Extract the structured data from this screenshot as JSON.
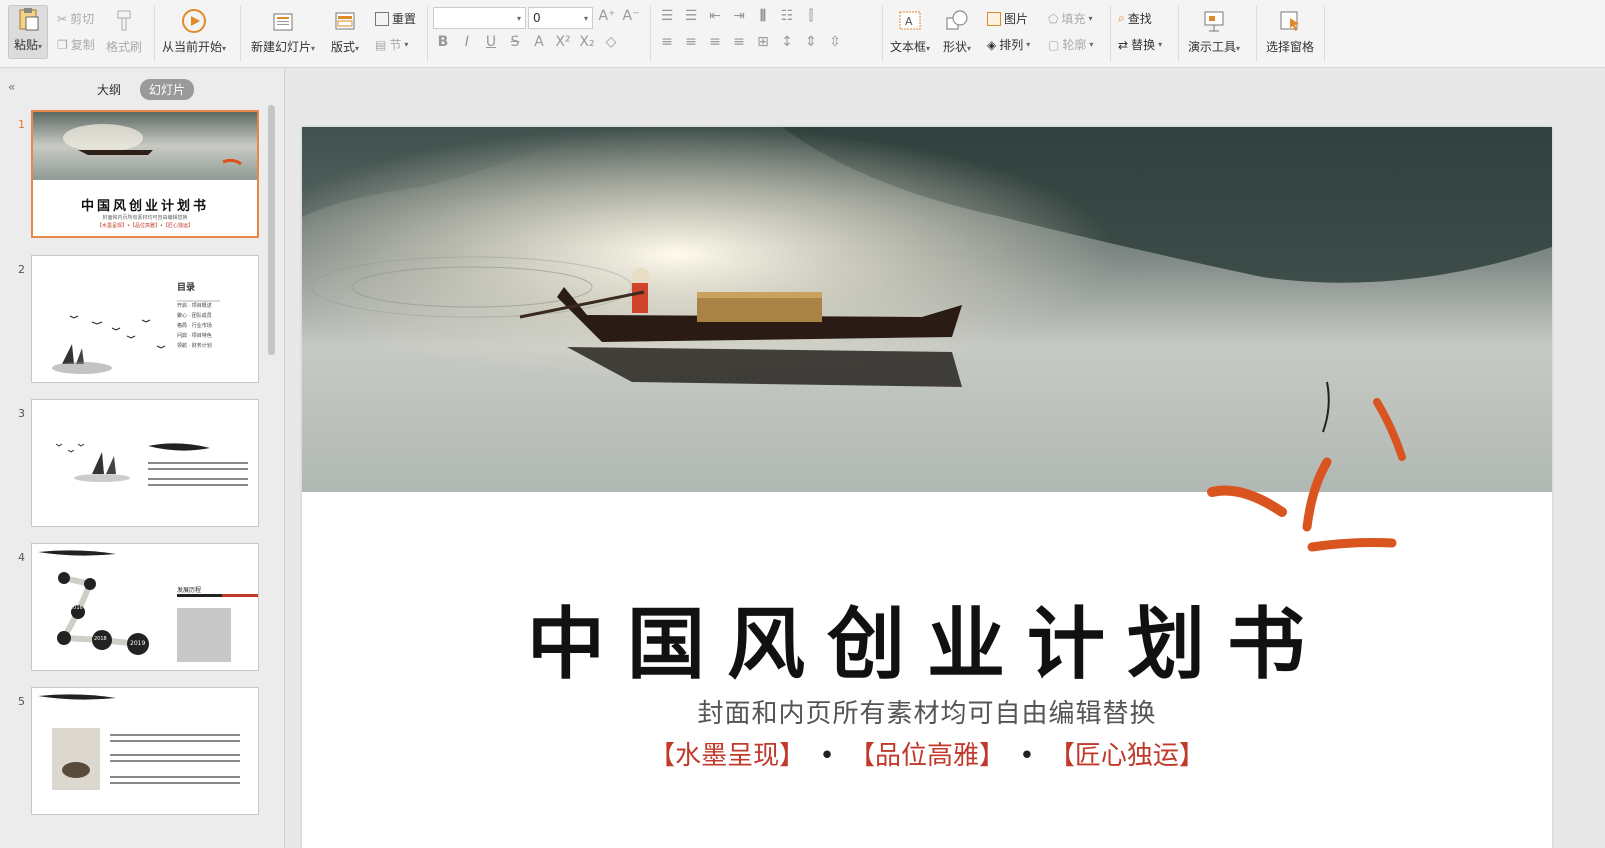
{
  "ribbon": {
    "paste": "粘贴",
    "cut": "剪切",
    "copy": "复制",
    "format_painter": "格式刷",
    "from_current": "从当前开始",
    "new_slide": "新建幻灯片",
    "layout": "版式",
    "reset": "重置",
    "section": "节",
    "font_name": "",
    "font_size": "0",
    "textbox": "文本框",
    "shape": "形状",
    "picture": "图片",
    "arrange": "排列",
    "fill": "填充",
    "outline": "轮廓",
    "find": "查找",
    "replace": "替换",
    "presenter_tools": "演示工具",
    "selection_pane": "选择窗格"
  },
  "sidebar": {
    "tabs": [
      {
        "label": "大纲"
      },
      {
        "label": "幻灯片"
      }
    ],
    "slides": [
      {
        "num": "1",
        "title": "中国风创业计划书",
        "sub": "封面和内页所有素材均可自由编辑替换",
        "tags": "【水墨呈现】•【品位高雅】•【匠心独运】"
      },
      {
        "num": "2",
        "title": "目录",
        "lines": [
          "开启 · 项目概述",
          "聚心 · 团队成员",
          "格局 · 行业市场",
          "问鼎 · 项目特色",
          "领航 · 财务计划"
        ]
      },
      {
        "num": "3"
      },
      {
        "num": "4",
        "years": [
          "2016",
          "2018",
          "2019"
        ],
        "label": "发展历程"
      },
      {
        "num": "5"
      }
    ]
  },
  "slide": {
    "title": "中国风创业计划书",
    "subtitle": "封面和内页所有素材均可自由编辑替换",
    "tag1": "【水墨呈现】",
    "tag2": "【品位高雅】",
    "tag3": "【匠心独运】",
    "dot": "•"
  },
  "colors": {
    "accent": "#e8874a",
    "tag_red": "#c0392b"
  }
}
